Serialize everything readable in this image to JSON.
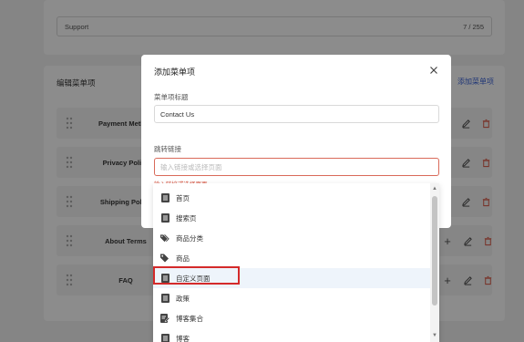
{
  "background": {
    "support_field": {
      "value": "Support",
      "counter": "7 / 255"
    },
    "section_title": "编辑菜单项",
    "add_link": "添加菜单项",
    "menu_items": [
      {
        "label": "Payment Method"
      },
      {
        "label": "Privacy Policy"
      },
      {
        "label": "Shipping Policy"
      },
      {
        "label": "About Terms"
      },
      {
        "label": "FAQ"
      }
    ]
  },
  "dialog": {
    "title": "添加菜单项",
    "title_label": "菜单项标题",
    "title_value": "Contact Us",
    "link_label": "跳转链接",
    "link_placeholder": "输入链接或选择页面",
    "link_error": "输入链接或选择页面"
  },
  "dropdown": {
    "items": [
      {
        "label": "首页",
        "icon": "document-icon"
      },
      {
        "label": "搜索页",
        "icon": "document-icon"
      },
      {
        "label": "商品分类",
        "icon": "tags-icon"
      },
      {
        "label": "商品",
        "icon": "tag-icon"
      },
      {
        "label": "自定义页面",
        "icon": "document-icon"
      },
      {
        "label": "政策",
        "icon": "document-icon"
      },
      {
        "label": "博客集合",
        "icon": "edit-document-icon"
      },
      {
        "label": "博客",
        "icon": "document-icon"
      }
    ],
    "highlighted_index": 4
  },
  "colors": {
    "accent": "#3a63d8",
    "error": "#d8503c",
    "highlight_box": "#d42a2a",
    "delete_icon": "#d8503c"
  }
}
